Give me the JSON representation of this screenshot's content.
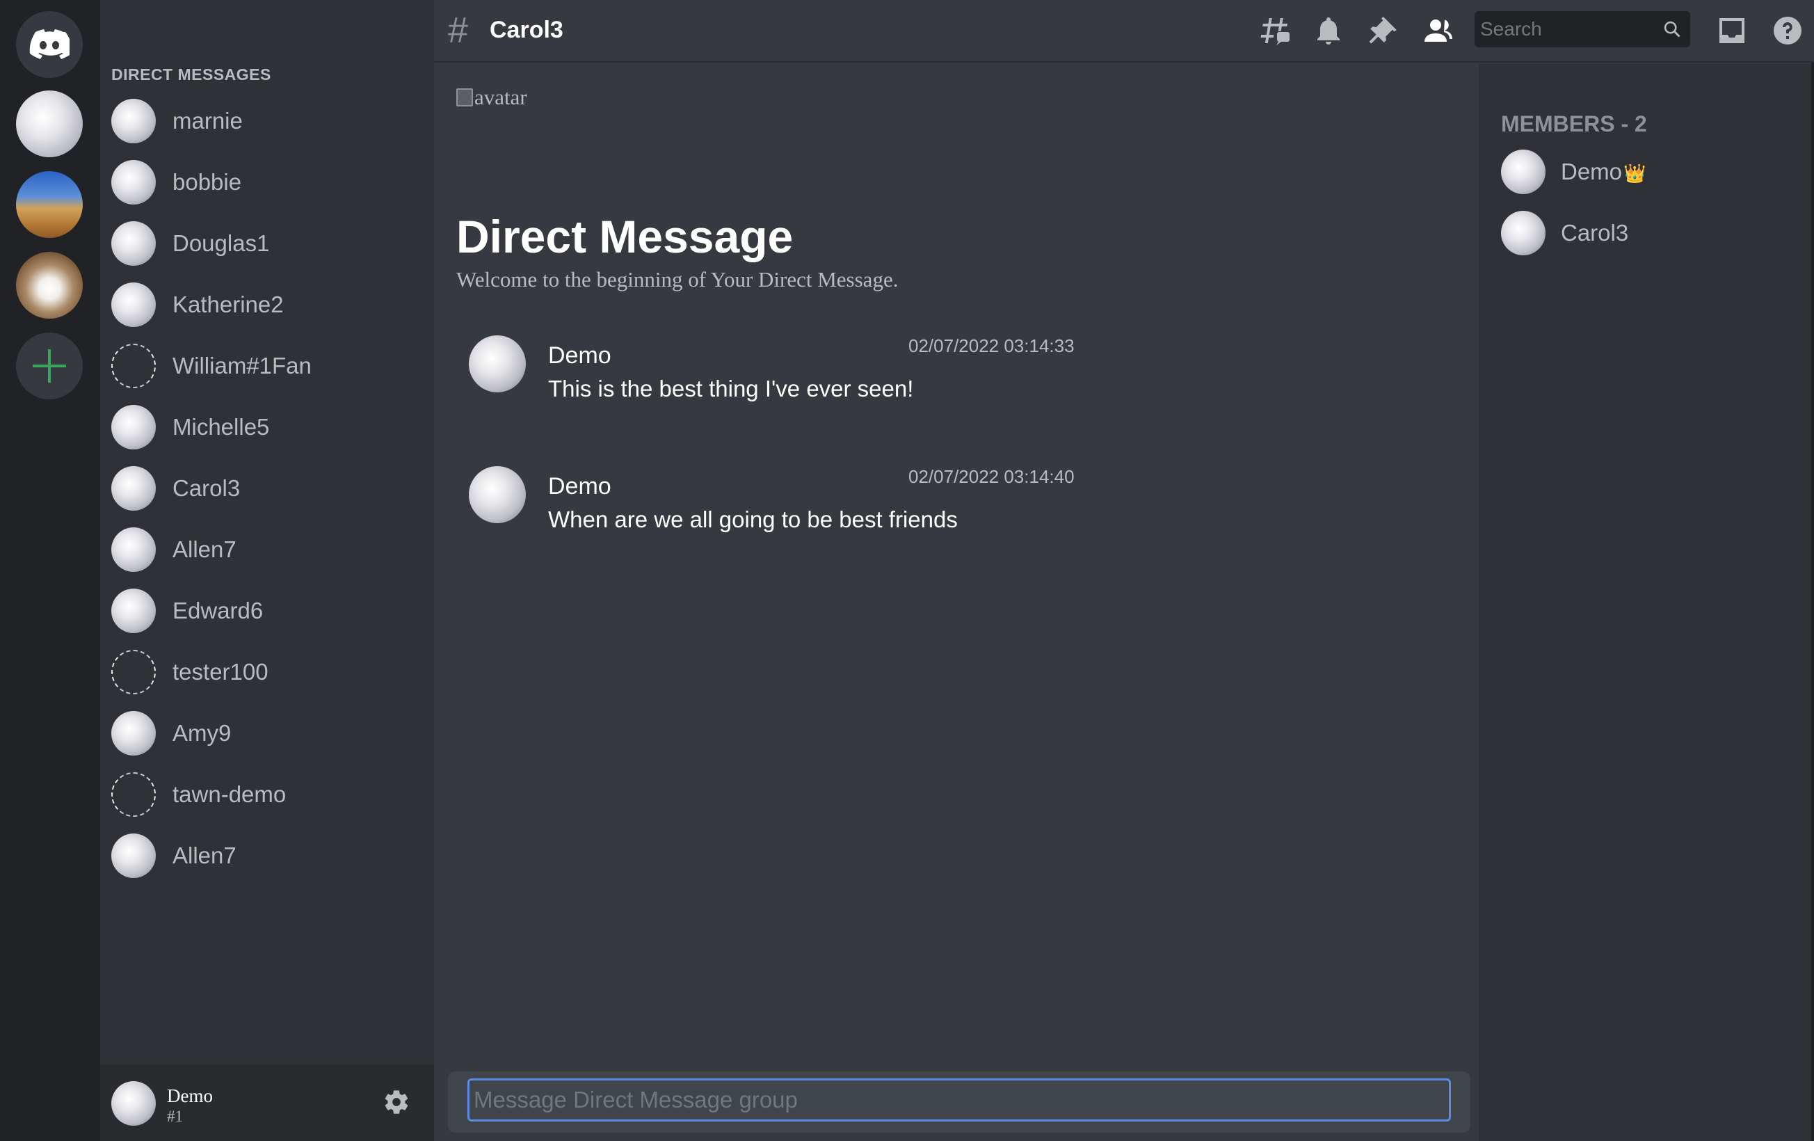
{
  "servers": [
    {
      "name": "home",
      "icon": "discord-logo-icon"
    },
    {
      "name": "server-1",
      "icon": "avatar-image"
    },
    {
      "name": "server-2",
      "icon": "desert-image"
    },
    {
      "name": "server-3",
      "icon": "yeti-image"
    },
    {
      "name": "add-server",
      "icon": "plus-icon"
    }
  ],
  "sidebar": {
    "header": "DIRECT MESSAGES",
    "items": [
      {
        "label": "marnie",
        "avatar": true
      },
      {
        "label": "bobbie",
        "avatar": true
      },
      {
        "label": "Douglas1",
        "avatar": true
      },
      {
        "label": "Katherine2",
        "avatar": true
      },
      {
        "label": "William#1Fan",
        "avatar": false
      },
      {
        "label": "Michelle5",
        "avatar": true
      },
      {
        "label": "Carol3",
        "avatar": true
      },
      {
        "label": "Allen7",
        "avatar": true
      },
      {
        "label": "Edward6",
        "avatar": true
      },
      {
        "label": "tester100",
        "avatar": false
      },
      {
        "label": "Amy9",
        "avatar": true
      },
      {
        "label": "tawn-demo",
        "avatar": false
      },
      {
        "label": "Allen7",
        "avatar": true
      }
    ]
  },
  "user_panel": {
    "name": "Demo",
    "tag": "#1"
  },
  "topbar": {
    "hash": "#",
    "channel": "Carol3",
    "search_placeholder": "Search"
  },
  "chat": {
    "broken_image_alt": "avatar",
    "heading": "Direct Message",
    "welcome": "Welcome to the beginning of Your Direct Message.",
    "messages": [
      {
        "author": "Demo",
        "time": "02/07/2022 03:14:33",
        "text": "This is the best thing I've ever seen!"
      },
      {
        "author": "Demo",
        "time": "02/07/2022 03:14:40",
        "text": "When are we all going to be best friends"
      }
    ]
  },
  "composer": {
    "placeholder": "Message Direct Message group"
  },
  "members": {
    "title": "MEMBERS - 2",
    "list": [
      {
        "name": "Demo",
        "badge": "👑"
      },
      {
        "name": "Carol3",
        "badge": ""
      }
    ]
  },
  "colors": {
    "background": "#36393f",
    "sidebar": "#2f3136",
    "rail": "#202225",
    "accent_green": "#3ba55d",
    "focus_blue": "#5b8be3"
  }
}
